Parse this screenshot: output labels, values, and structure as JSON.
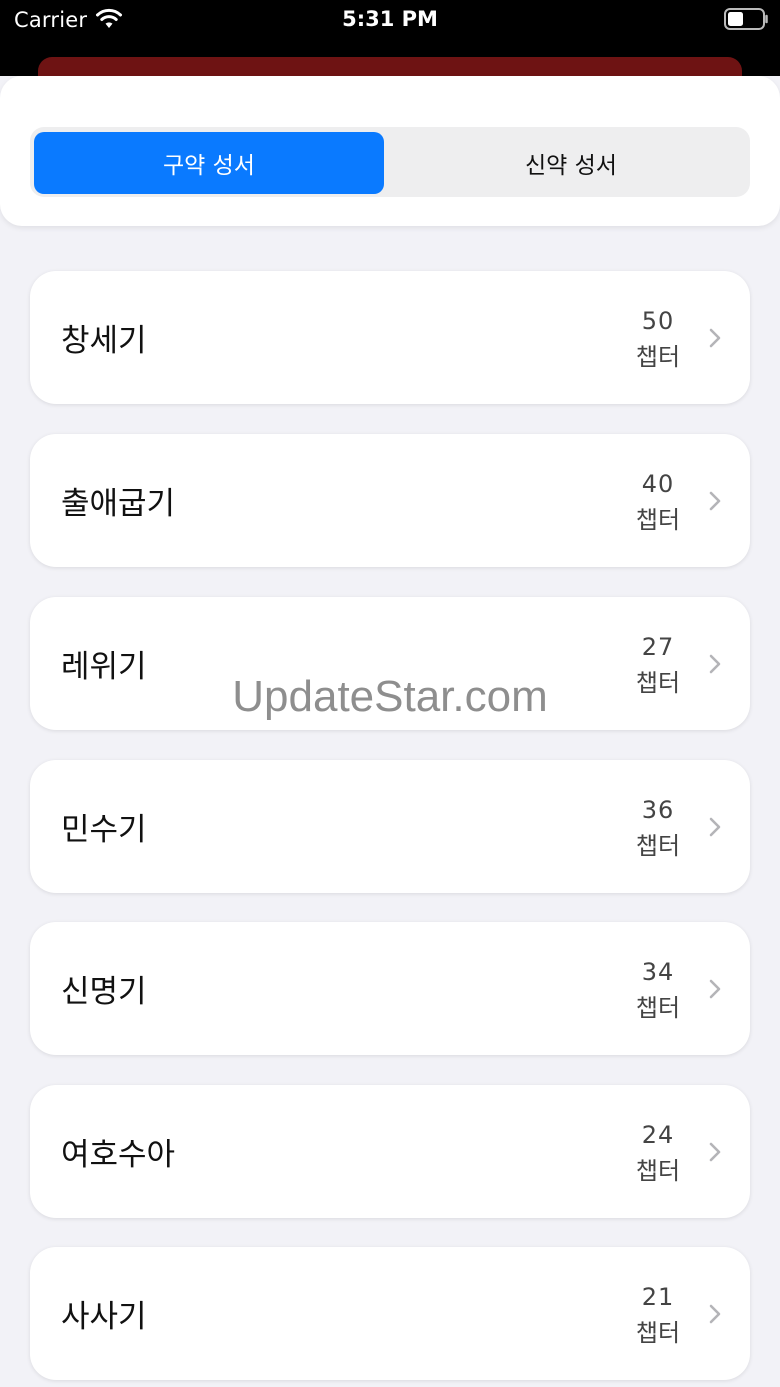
{
  "status_bar": {
    "carrier": "Carrier",
    "time": "5:31 PM"
  },
  "segments": [
    {
      "label": "구약 성서",
      "selected": true
    },
    {
      "label": "신약 성서",
      "selected": false
    }
  ],
  "books": [
    {
      "name": "창세기",
      "count": "50",
      "unit": "챕터"
    },
    {
      "name": "출애굽기",
      "count": "40",
      "unit": "챕터"
    },
    {
      "name": "레위기",
      "count": "27",
      "unit": "챕터"
    },
    {
      "name": "민수기",
      "count": "36",
      "unit": "챕터"
    },
    {
      "name": "신명기",
      "count": "34",
      "unit": "챕터"
    },
    {
      "name": "여호수아",
      "count": "24",
      "unit": "챕터"
    },
    {
      "name": "사사기",
      "count": "21",
      "unit": "챕터"
    }
  ],
  "watermark": "UpdateStar.com",
  "colors": {
    "accent": "#0a7aff",
    "background": "#f2f2f7",
    "sheet": "#6e1313"
  }
}
